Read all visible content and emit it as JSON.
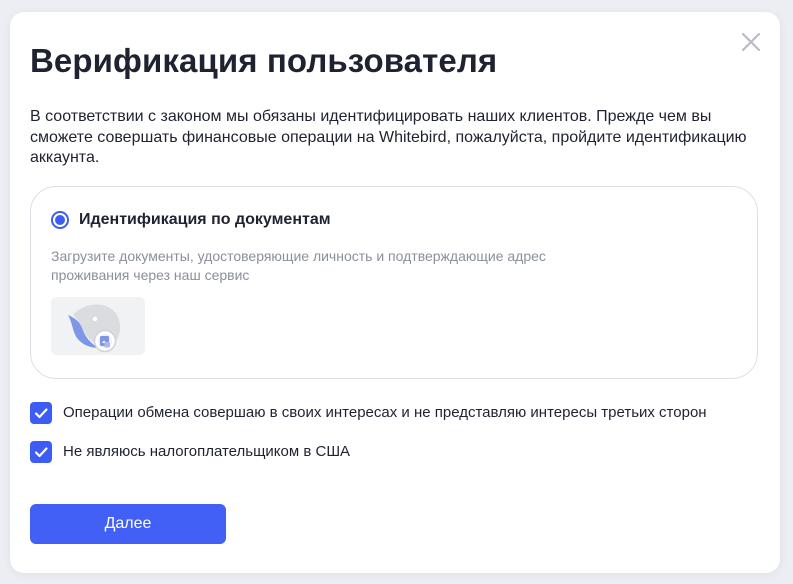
{
  "modal": {
    "title": "Верификация пользователя",
    "intro": "В соответствии с законом мы обязаны идентифицировать наших клиентов. Прежде чем вы сможете совершать финансовые операции на Whitebird, пожалуйста, пройдите идентификацию аккаунта.",
    "close_icon": "close-icon"
  },
  "verification_option": {
    "selected": true,
    "title": "Идентификация по документам",
    "description": "Загрузите документы, удостоверяющие личность и подтверждающие адрес проживания через наш сервис",
    "thumbnail_icon": "whitebird-logo-document-icon"
  },
  "checkboxes": [
    {
      "label": "Операции обмена совершаю в своих интересах и не представляю интересы третьих сторон",
      "checked": true
    },
    {
      "label": "Не являюсь налогоплательщиком в США",
      "checked": true
    }
  ],
  "actions": {
    "next_label": "Далее"
  },
  "colors": {
    "accent": "#3d5bf5",
    "button": "#4260f6",
    "text": "#1f2230",
    "muted_text": "#8a8f9c",
    "border": "#dcdfe6",
    "backdrop": "#eceef3"
  }
}
